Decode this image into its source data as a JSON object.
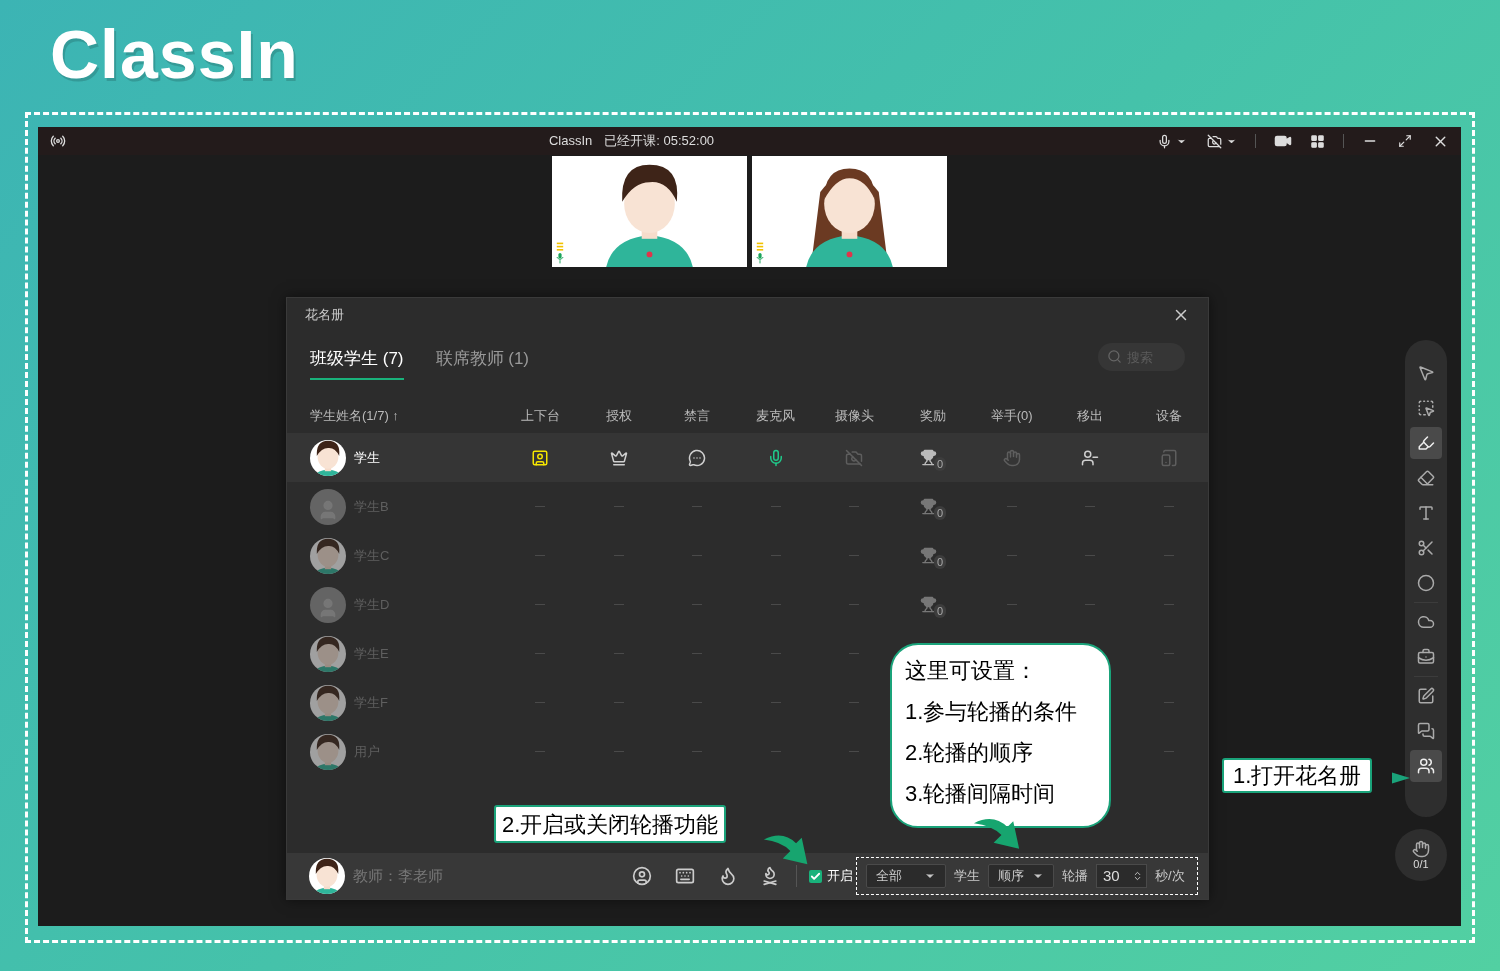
{
  "brand": {
    "logo": "ClassIn"
  },
  "titlebar": {
    "app": "ClassIn",
    "status": "已经开课: 05:52:00"
  },
  "roster": {
    "title": "花名册",
    "tabs": [
      {
        "label": "班级学生 (7)",
        "selected": true
      },
      {
        "label": "联席教师 (1)",
        "selected": false
      }
    ],
    "search": {
      "placeholder": "搜索"
    },
    "columns": [
      "学生姓名(1/7) ↑",
      "上下台",
      "授权",
      "禁言",
      "麦克风",
      "摄像头",
      "奖励",
      "举手(0)",
      "移出",
      "设备"
    ],
    "students": [
      {
        "name": "学生",
        "online": true,
        "controls": [
          {
            "kind": "stage",
            "on": true
          },
          {
            "kind": "authorize",
            "on": true
          },
          {
            "kind": "chat",
            "on": true
          },
          {
            "kind": "mic",
            "on": true
          },
          {
            "kind": "camera",
            "on": false
          },
          {
            "kind": "reward",
            "count": "0"
          },
          {
            "kind": "hand",
            "on": false
          },
          {
            "kind": "remove",
            "on": true
          },
          {
            "kind": "device",
            "on": false
          }
        ]
      },
      {
        "name": "学生B",
        "online": false,
        "kind": "default",
        "reward_count": "0"
      },
      {
        "name": "学生C",
        "online": false,
        "reward_count": "0"
      },
      {
        "name": "学生D",
        "online": false,
        "kind": "default",
        "reward_count": "0"
      },
      {
        "name": "学生E",
        "online": false
      },
      {
        "name": "学生F",
        "online": false
      },
      {
        "name": "用户",
        "online": false
      }
    ],
    "teacher": {
      "label": "教师：李老师"
    },
    "rotation": {
      "enabled": true,
      "enable_label": "开启",
      "scope": "全部",
      "target_label": "学生",
      "order": "顺序",
      "rotate_label": "轮播",
      "interval": "30",
      "unit": "秒/次"
    }
  },
  "tools": [
    {
      "kind": "pointer",
      "selected": false
    },
    {
      "kind": "select",
      "selected": false
    },
    {
      "kind": "pen",
      "selected": true
    },
    {
      "kind": "eraser",
      "selected": false
    },
    {
      "kind": "text",
      "selected": false
    },
    {
      "kind": "scissors",
      "selected": false
    },
    {
      "kind": "shape",
      "selected": false
    },
    {
      "kind": "cloud",
      "selected": false
    },
    {
      "kind": "toolbox",
      "selected": false
    },
    {
      "kind": "edit",
      "selected": false
    },
    {
      "kind": "chat",
      "selected": false
    },
    {
      "kind": "roster",
      "selected": true
    }
  ],
  "hand_raise": {
    "count": "0/1"
  },
  "annotations": {
    "bubble": [
      "这里可设置：",
      "1.参与轮播的条件",
      "2.轮播的顺序",
      "3.轮播间隔时间"
    ],
    "toggle_tip": "2.开启或关闭轮播功能",
    "roster_tip": "1.打开花名册"
  }
}
